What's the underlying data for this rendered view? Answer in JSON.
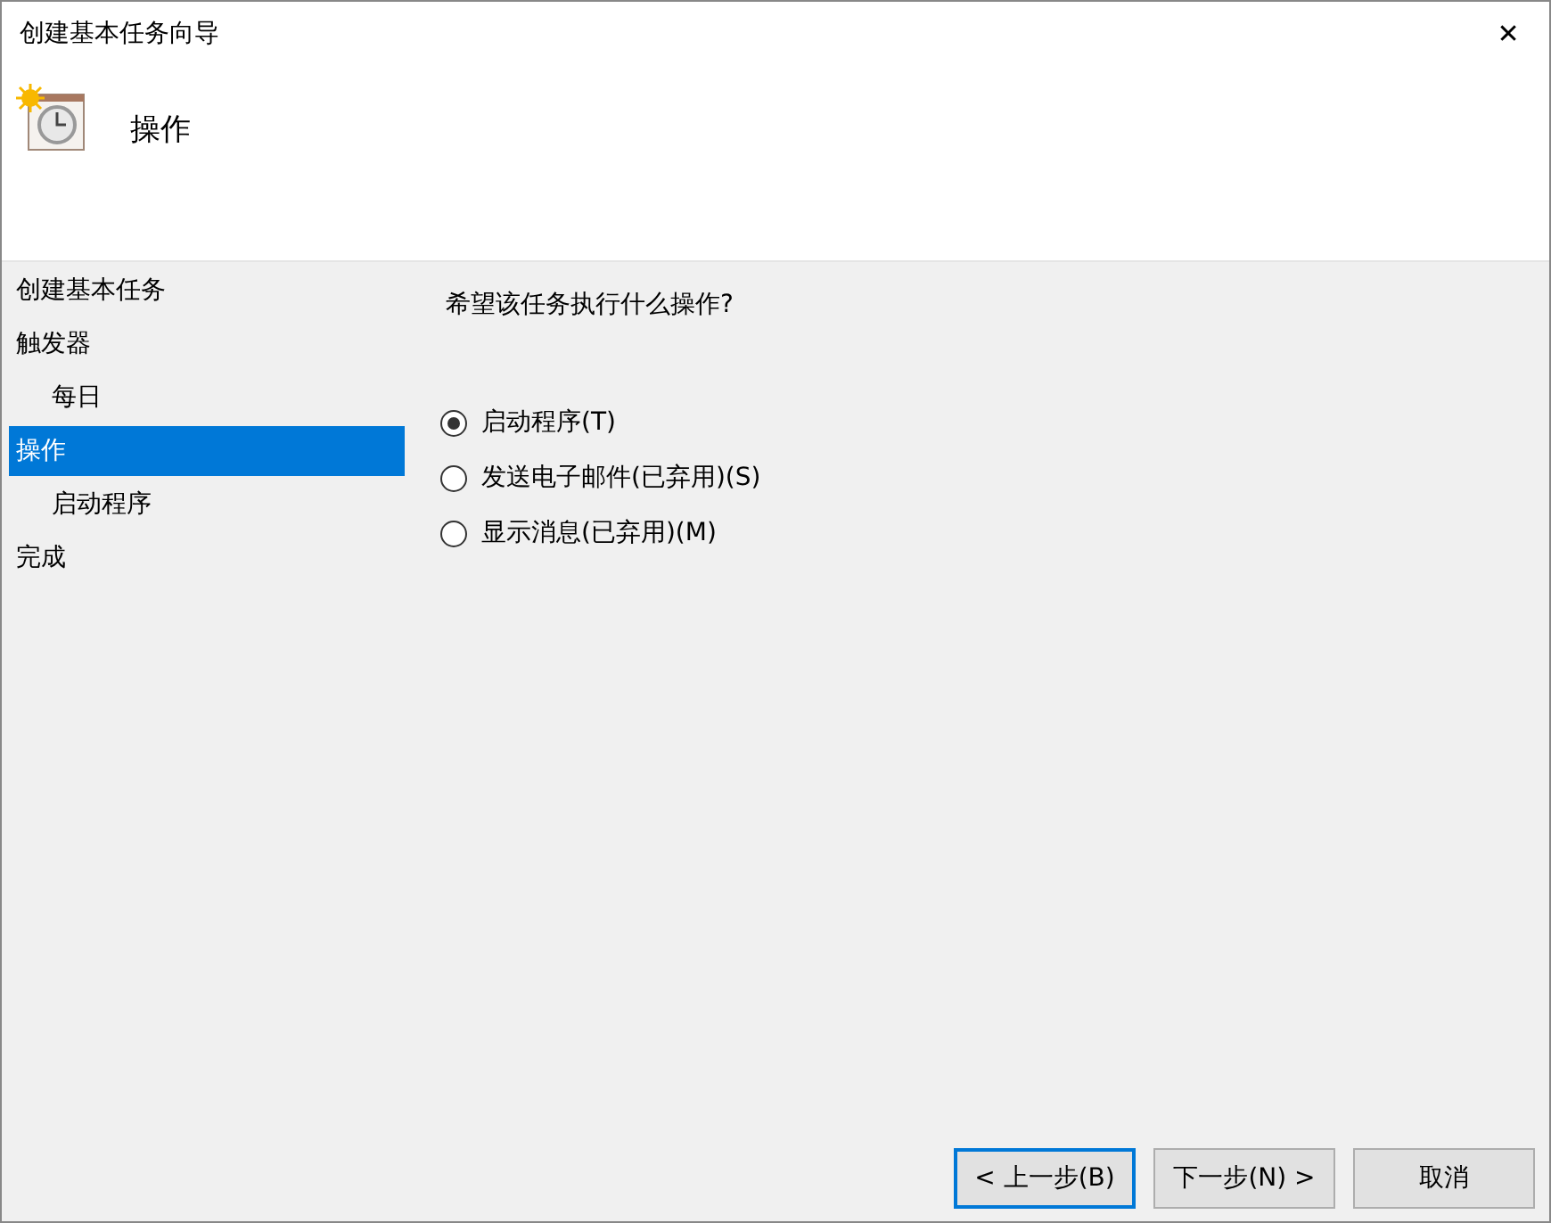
{
  "window": {
    "title": "创建基本任务向导",
    "close": "✕"
  },
  "header": {
    "title": "操作"
  },
  "sidebar": {
    "items": [
      {
        "label": "创建基本任务",
        "selected": false
      },
      {
        "label": "触发器",
        "selected": false,
        "children": [
          {
            "label": "每日",
            "selected": false
          }
        ]
      },
      {
        "label": "操作",
        "selected": true,
        "children": [
          {
            "label": "启动程序",
            "selected": false
          }
        ]
      },
      {
        "label": "完成",
        "selected": false
      }
    ]
  },
  "question": "希望该任务执行什么操作?",
  "options": [
    {
      "label": "启动程序(T)",
      "selected": true
    },
    {
      "label": "发送电子邮件(已弃用)(S)",
      "selected": false
    },
    {
      "label": "显示消息(已弃用)(M)",
      "selected": false
    }
  ],
  "buttons": [
    {
      "label": "< 上一步(B)",
      "focused": true
    },
    {
      "label": "下一步(N) >",
      "focused": false
    },
    {
      "label": "取消",
      "focused": false
    }
  ]
}
